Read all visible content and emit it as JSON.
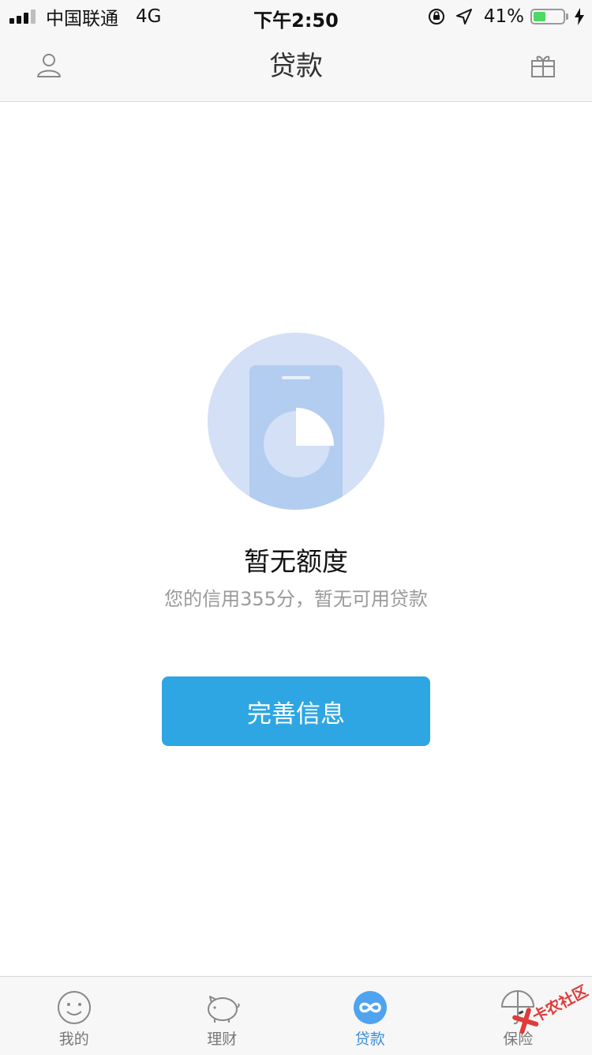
{
  "status_bar": {
    "carrier": "中国联通",
    "network": "4G",
    "time": "下午2:50",
    "battery_percent_label": "41%",
    "battery_level": 0.41,
    "battery_color": "#4cd964",
    "icons": [
      "signal-icon",
      "rotation-lock-icon",
      "location-arrow-icon",
      "battery-icon",
      "charging-bolt-icon"
    ]
  },
  "nav": {
    "title": "贷款",
    "left_icon": "user-profile-icon",
    "right_icon": "gift-icon"
  },
  "empty_state": {
    "illustration_icon": "phone-pie-chart-icon",
    "title": "暂无额度",
    "subtitle": "您的信用355分，暂无可用贷款",
    "button_label": "完善信息"
  },
  "tab_bar": {
    "tabs": [
      {
        "label": "我的",
        "icon": "smiley-face-icon",
        "active": false
      },
      {
        "label": "理财",
        "icon": "piggy-bank-icon",
        "active": false
      },
      {
        "label": "贷款",
        "icon": "infinity-loan-icon",
        "active": true
      },
      {
        "label": "保险",
        "icon": "umbrella-icon",
        "active": false
      }
    ]
  },
  "watermark": {
    "text": "卡农社区"
  },
  "colors": {
    "accent": "#2ea6e3",
    "active_tab": "#3b8fd9",
    "illustration_bg": "#d3e0f6",
    "illustration_fg": "#b3cdf1"
  }
}
